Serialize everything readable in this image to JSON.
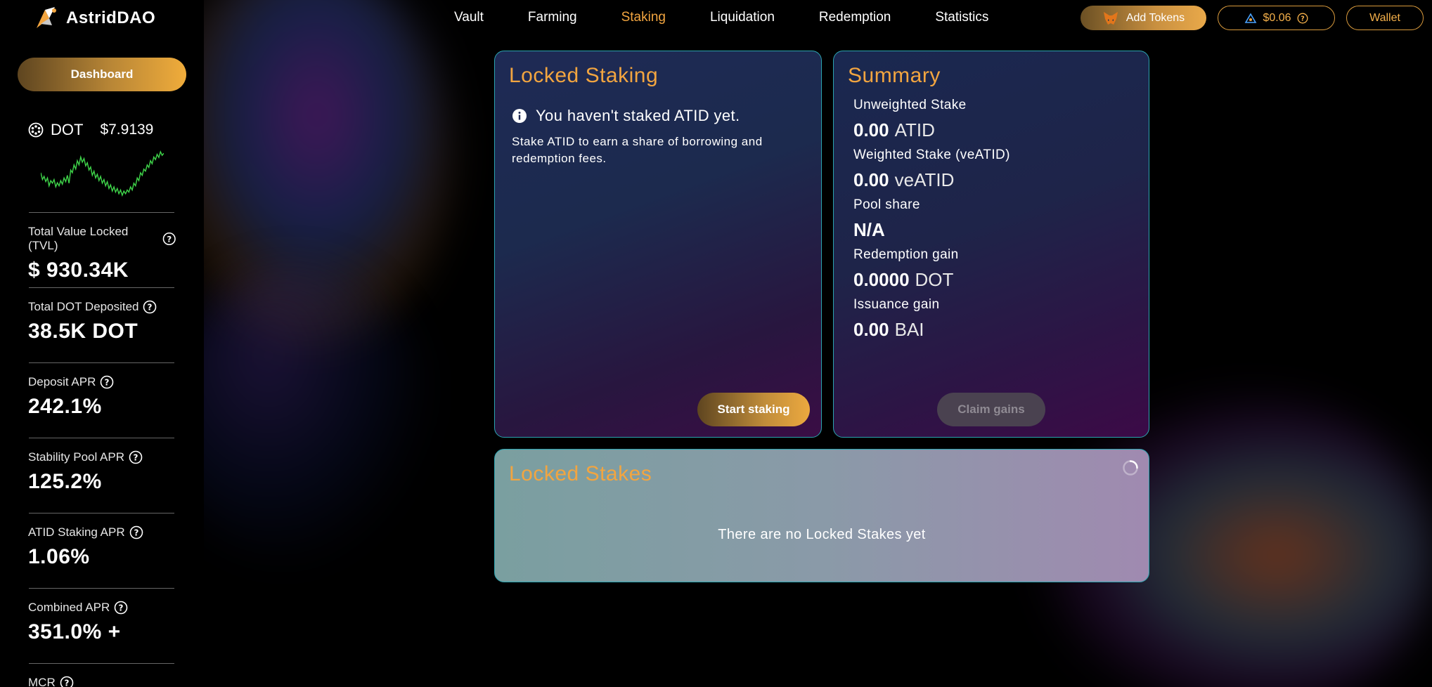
{
  "app": {
    "name": "AstridDAO"
  },
  "sidebar": {
    "dashboard_label": "Dashboard",
    "price": {
      "token": "DOT",
      "value": "$7.9139"
    },
    "stats": [
      {
        "label": "Total Value Locked (TVL)",
        "value": "$ 930.34K"
      },
      {
        "label": "Total DOT Deposited",
        "value": "38.5K DOT"
      },
      {
        "label": "Deposit APR",
        "value": "242.1%"
      },
      {
        "label": "Stability Pool APR",
        "value": "125.2%"
      },
      {
        "label": "ATID Staking APR",
        "value": "1.06%"
      },
      {
        "label": "Combined APR",
        "value": "351.0% +"
      },
      {
        "label": "MCR",
        "value": ""
      }
    ]
  },
  "nav": {
    "items": [
      "Vault",
      "Farming",
      "Staking",
      "Liquidation",
      "Redemption",
      "Statistics"
    ],
    "active": "Staking"
  },
  "top_actions": {
    "add_tokens": "Add Tokens",
    "atid_price": "$0.06",
    "wallet": "Wallet"
  },
  "locked_staking": {
    "title": "Locked Staking",
    "notice": "You haven't staked ATID yet.",
    "description": "Stake ATID to earn a share of borrowing and redemption fees.",
    "button": "Start staking"
  },
  "summary": {
    "title": "Summary",
    "rows": [
      {
        "label": "Unweighted Stake",
        "value": "0.00",
        "unit": "ATID"
      },
      {
        "label": "Weighted Stake (veATID)",
        "value": "0.00",
        "unit": "veATID"
      },
      {
        "label": "Pool share",
        "value": "N/A",
        "unit": ""
      },
      {
        "label": "Redemption gain",
        "value": "0.0000",
        "unit": "DOT"
      },
      {
        "label": "Issuance gain",
        "value": "0.00",
        "unit": "BAI"
      }
    ],
    "button": "Claim gains"
  },
  "locked_stakes": {
    "title": "Locked Stakes",
    "empty_text": "There are no Locked Stakes yet"
  },
  "colors": {
    "accent": "#f2a540",
    "panel_border": "#2ba4b0",
    "sparkline": "#3fd64a"
  },
  "chart_data": {
    "type": "line",
    "title": "",
    "xlabel": "",
    "ylabel": "",
    "series": [
      {
        "values": [
          0.55,
          0.42,
          0.48,
          0.38,
          0.45,
          0.3,
          0.4,
          0.35,
          0.42,
          0.28,
          0.36,
          0.3,
          0.4,
          0.33,
          0.45,
          0.38,
          0.5,
          0.35,
          0.6,
          0.55,
          0.7,
          0.62,
          0.78,
          0.7,
          0.85,
          0.75,
          0.82,
          0.68,
          0.74,
          0.6,
          0.66,
          0.5,
          0.58,
          0.45,
          0.52,
          0.4,
          0.48,
          0.35,
          0.42,
          0.3,
          0.38,
          0.25,
          0.32,
          0.2,
          0.28,
          0.18,
          0.25,
          0.15,
          0.22,
          0.12,
          0.2,
          0.15,
          0.22,
          0.18,
          0.28,
          0.22,
          0.35,
          0.3,
          0.45,
          0.4,
          0.55,
          0.5,
          0.62,
          0.58,
          0.7,
          0.65,
          0.78,
          0.72,
          0.85,
          0.8,
          0.9,
          0.84,
          0.95,
          0.88,
          0.92
        ]
      }
    ]
  }
}
